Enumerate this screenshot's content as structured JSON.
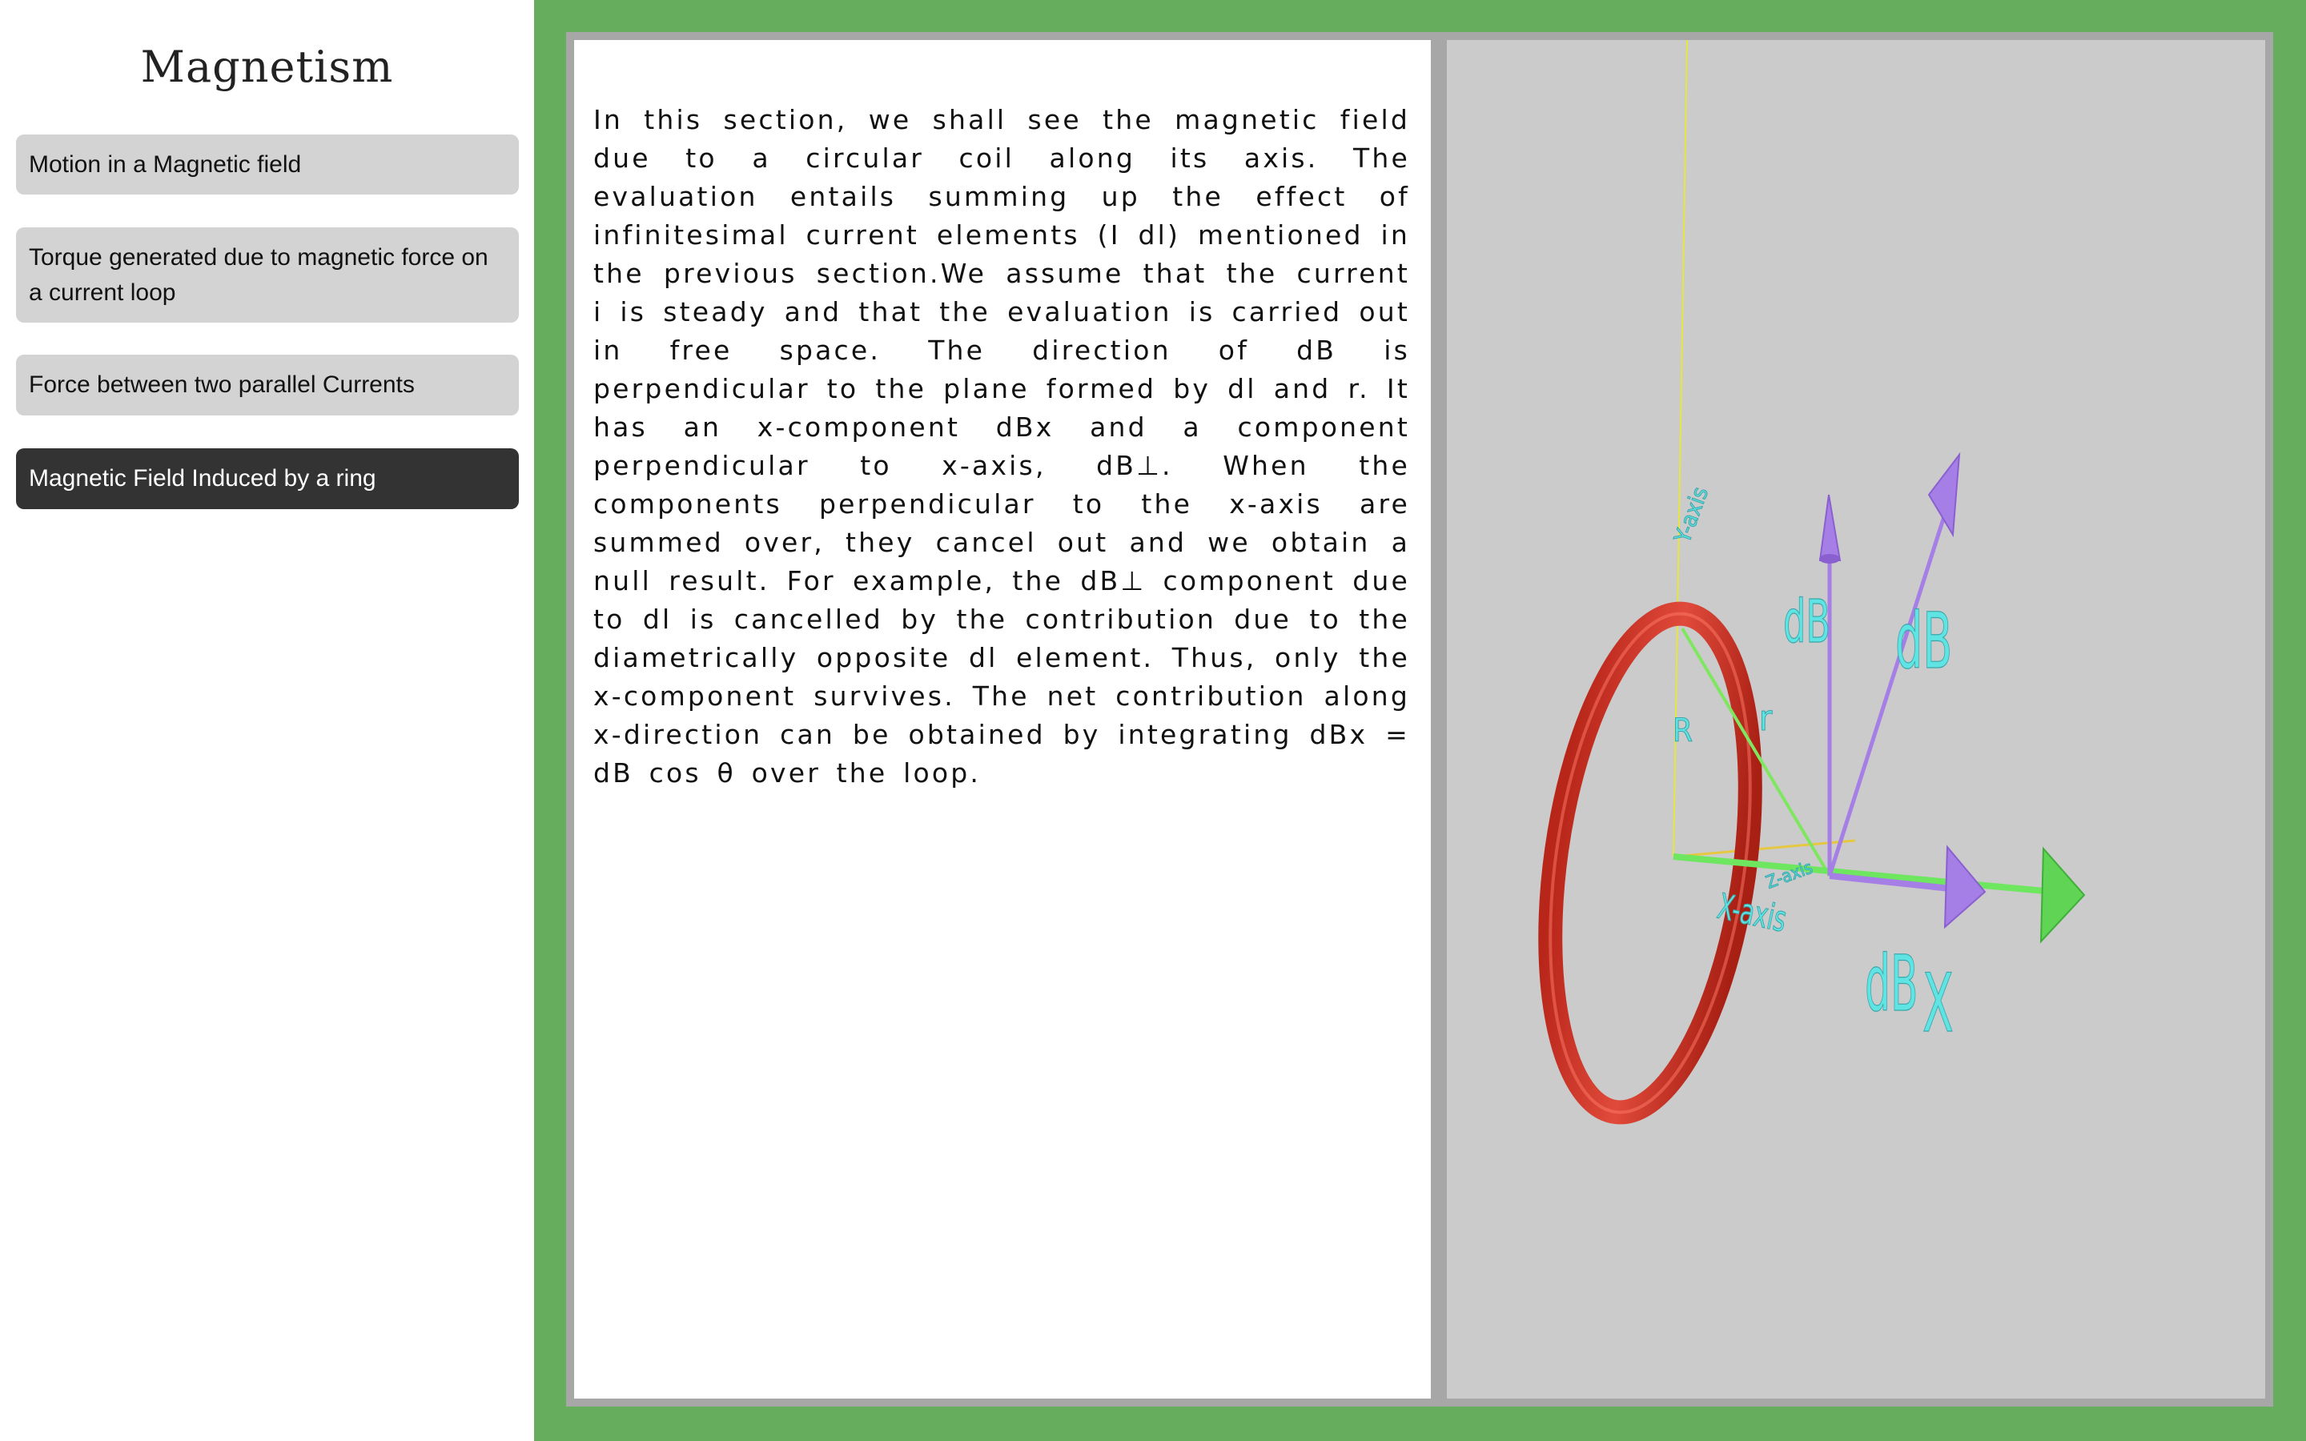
{
  "sidebar": {
    "title": "Magnetism",
    "items": [
      {
        "label": "Motion in a Magnetic field",
        "active": false
      },
      {
        "label": "Torque generated due to magnetic force on a current loop",
        "active": false
      },
      {
        "label": "Force between two parallel Currents",
        "active": false
      },
      {
        "label": "Magnetic Field Induced by a ring",
        "active": true
      }
    ]
  },
  "content": {
    "paragraph": "In this section, we shall see the magnetic field due to a circular coil along its axis. The evaluation entails summing up the effect of infinitesimal current elements (I dl) mentioned in the previous section.We assume that the current i is steady and that the evaluation is carried out in free space. The direction of dB is perpendicular to the plane formed by dl and r. It has an x-component dBx and a component perpendicular to x-axis, dB⊥. When the components perpendicular to the x-axis are summed over, they cancel out and we obtain a null result. For example, the dB⊥ component due to dl is cancelled by the contribution due to the diametrically opposite dl element. Thus, only the x-component survives. The net contribution along x-direction can be obtained by integrating dBx = dB cos θ over the loop."
  },
  "scene": {
    "labels": {
      "y_axis": "Y-axis",
      "x_axis": "X-axis",
      "z_axis": "Z-axis",
      "radius": "R",
      "r": "r",
      "db_vertical": "dB",
      "db_slanted": "dB",
      "db_axis": "dB",
      "x": "X"
    },
    "colors": {
      "ring": "#d63425",
      "db_arrows": "#a57ee6",
      "x_arrow": "#6ee65f",
      "y_axis_line": "#e6e640",
      "labels": "#5fe3e3",
      "frame_green": "#66ad5d"
    }
  }
}
